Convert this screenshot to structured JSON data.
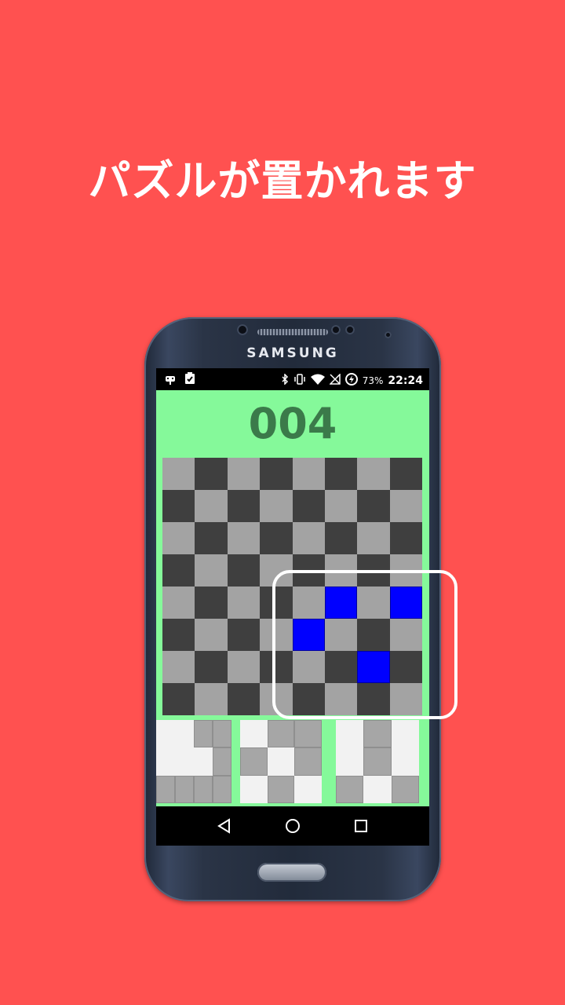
{
  "headline": "パズルが置かれます",
  "phone": {
    "brand": "SAMSUNG"
  },
  "status_bar": {
    "left_icons": [
      "android-debug-icon",
      "clipboard-check-icon"
    ],
    "right_icons": [
      "bluetooth-icon",
      "vibrate-icon",
      "wifi-icon",
      "no-signal-icon",
      "battery-saver-icon"
    ],
    "battery": "73%",
    "clock": "22:24"
  },
  "game": {
    "score": "004",
    "board": [
      "LDLDLDLD",
      "DLDLDLDL",
      "LDLDLDLD",
      "DLDLDLDL",
      "LDLDLBLB",
      "DLDLBLDL",
      "LDLDLDBD",
      "DLDLDLDL"
    ],
    "pieces": [
      [
        "..##",
        "...#",
        "####"
      ],
      [
        ".##",
        "#.#",
        ".#."
      ],
      [
        ".#.",
        ".#.",
        "#.#"
      ]
    ]
  },
  "colors": {
    "background": "#ff5150",
    "app_background": "#85f99a",
    "cell_light": "#a3a3a3",
    "cell_dark": "#3f3f3f",
    "cell_placed": "#0000ff",
    "score_text": "#3b7a4a"
  },
  "nav": [
    "back-icon",
    "home-icon",
    "recents-icon"
  ]
}
